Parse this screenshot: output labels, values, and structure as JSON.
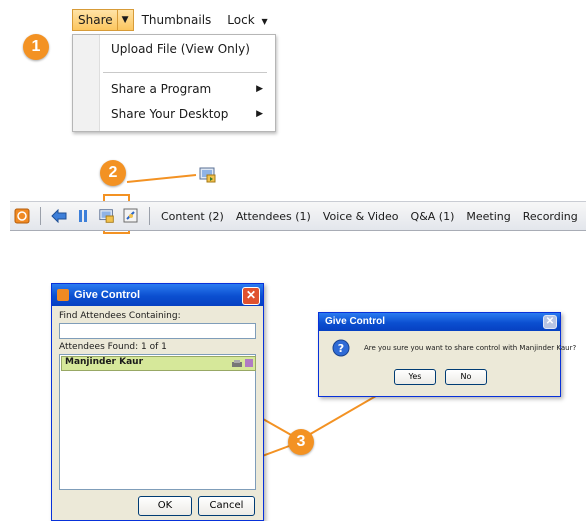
{
  "steps": [
    "1",
    "2",
    "3"
  ],
  "menu": {
    "share_label": "Share",
    "thumbnails_label": "Thumbnails",
    "lock_label": "Lock",
    "items": [
      "Upload File (View Only)",
      "Share a Program",
      "Share Your Desktop"
    ]
  },
  "toolbar": {
    "tabs": [
      "Content (2)",
      "Attendees (1)",
      "Voice & Video",
      "Q&A (1)",
      "Meeting",
      "Recording"
    ]
  },
  "give_control_dialog": {
    "title": "Give Control",
    "find_label": "Find Attendees Containing:",
    "search_value": "",
    "found_label": "Attendees Found: 1 of 1",
    "attendee": "Manjinder Kaur",
    "ok_label": "OK",
    "cancel_label": "Cancel"
  },
  "confirm_dialog": {
    "title": "Give Control",
    "message": "Are you sure you want to share control with Manjinder Kaur?",
    "yes_label": "Yes",
    "no_label": "No"
  },
  "colors": {
    "accent": "#f39223",
    "xp_title": "#0b4fd0",
    "highlight": "#d6e89a"
  }
}
